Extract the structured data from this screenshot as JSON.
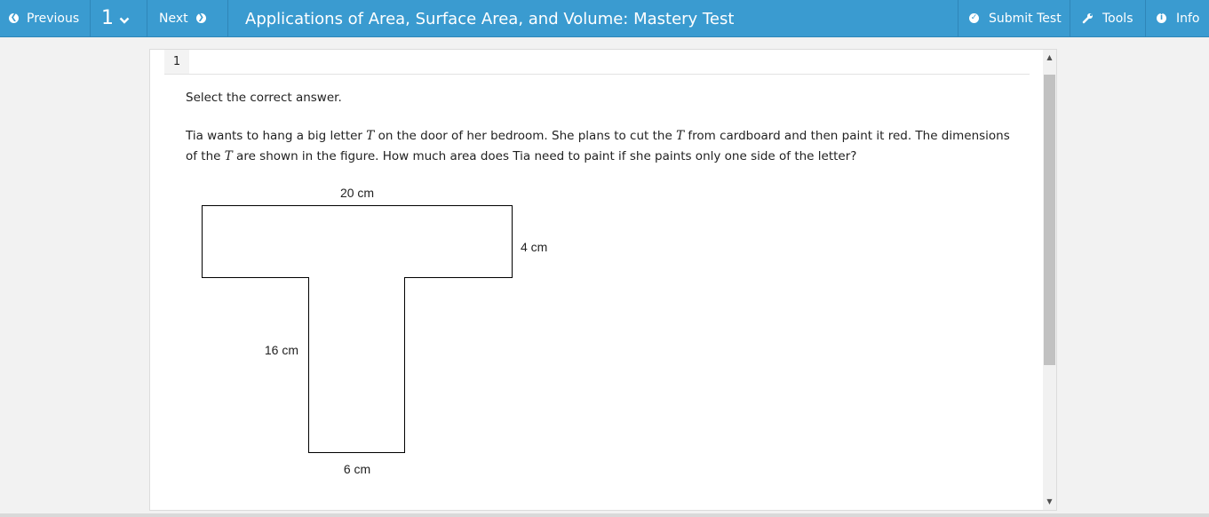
{
  "toolbar": {
    "previous_label": "Previous",
    "question_number": "1",
    "next_label": "Next",
    "title": "Applications of Area, Surface Area, and Volume: Mastery Test",
    "submit_label": "Submit Test",
    "tools_label": "Tools",
    "info_label": "Info"
  },
  "question": {
    "tab_number": "1",
    "instruction": "Select the correct answer.",
    "text_part1": "Tia wants to hang a big letter ",
    "letter": "T",
    "text_part2": " on the door of her bedroom. She plans to cut the ",
    "text_part3": " from cardboard and then paint it red. The dimensions of the ",
    "text_part4": " are shown in the figure. How much area does Tia need to paint if she paints only one side of the letter?",
    "figure": {
      "top_width_label": "20 cm",
      "top_height_label": "4 cm",
      "stem_height_label": "16 cm",
      "stem_width_label": "6 cm"
    }
  },
  "colors": {
    "toolbar": "#3a9bd0",
    "panel": "#ffffff",
    "background": "#f2f2f2"
  }
}
